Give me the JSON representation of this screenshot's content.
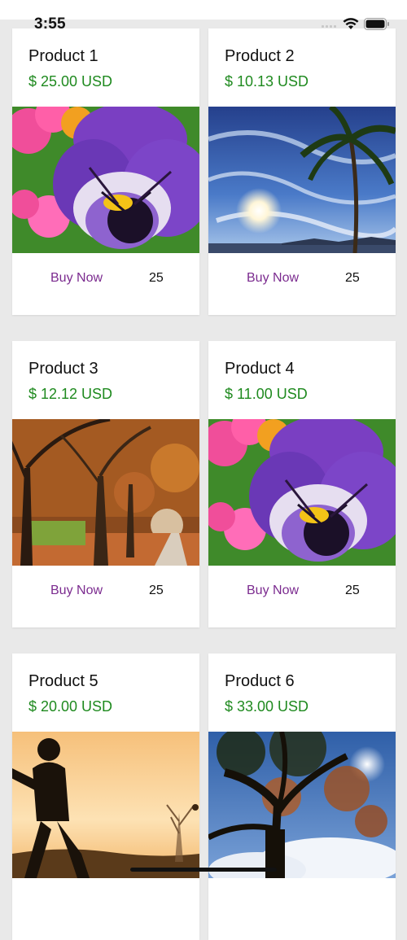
{
  "status_bar": {
    "time": "3:55"
  },
  "products": [
    {
      "name": "Product 1",
      "price": "$ 25.00 USD",
      "buy_label": "Buy Now",
      "quantity": "25",
      "image": "pansy-flower-photo"
    },
    {
      "name": "Product 2",
      "price": "$ 10.13 USD",
      "buy_label": "Buy Now",
      "quantity": "25",
      "image": "sky-palm-photo"
    },
    {
      "name": "Product 3",
      "price": "$ 12.12 USD",
      "buy_label": "Buy Now",
      "quantity": "25",
      "image": "autumn-trees-photo"
    },
    {
      "name": "Product 4",
      "price": "$ 11.00 USD",
      "buy_label": "Buy Now",
      "quantity": "25",
      "image": "pansy-flower-photo"
    },
    {
      "name": "Product 5",
      "price": "$ 20.00 USD",
      "image": "runner-silhouette-photo"
    },
    {
      "name": "Product 6",
      "price": "$ 33.00 USD",
      "image": "tree-sky-photo"
    }
  ],
  "colors": {
    "price": "#1f8a1f",
    "buy": "#7b2b8f",
    "background": "#e9e9e9"
  }
}
